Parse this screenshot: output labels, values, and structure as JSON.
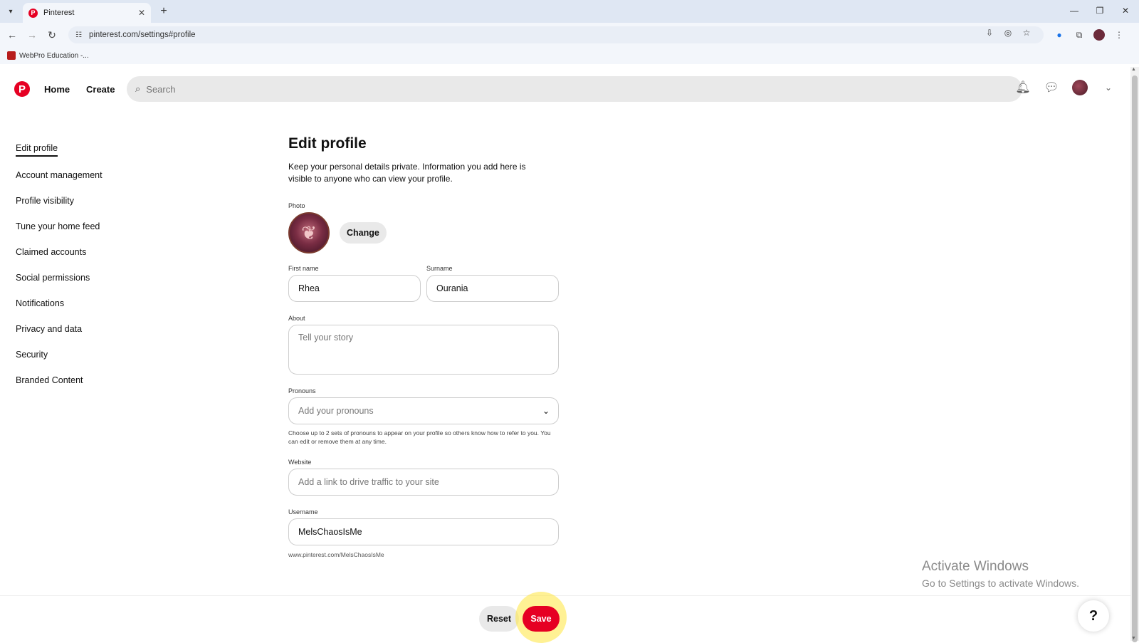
{
  "browser": {
    "tab_title": "Pinterest",
    "url": "pinterest.com/settings#profile",
    "bookmark": "WebPro Education -..."
  },
  "header": {
    "nav_home": "Home",
    "nav_create": "Create",
    "search_placeholder": "Search"
  },
  "sidebar": {
    "items": [
      {
        "label": "Edit profile"
      },
      {
        "label": "Account management"
      },
      {
        "label": "Profile visibility"
      },
      {
        "label": "Tune your home feed"
      },
      {
        "label": "Claimed accounts"
      },
      {
        "label": "Social permissions"
      },
      {
        "label": "Notifications"
      },
      {
        "label": "Privacy and data"
      },
      {
        "label": "Security"
      },
      {
        "label": "Branded Content"
      }
    ]
  },
  "form": {
    "title": "Edit profile",
    "description": "Keep your personal details private. Information you add here is visible to anyone who can view your profile.",
    "photo_label": "Photo",
    "change_button": "Change",
    "first_name_label": "First name",
    "first_name_value": "Rhea",
    "surname_label": "Surname",
    "surname_value": "Ourania",
    "about_label": "About",
    "about_placeholder": "Tell your story",
    "pronouns_label": "Pronouns",
    "pronouns_placeholder": "Add your pronouns",
    "pronouns_help": "Choose up to 2 sets of pronouns to appear on your profile so others know how to refer to you. You can edit or remove them at any time.",
    "website_label": "Website",
    "website_placeholder": "Add a link to drive traffic to your site",
    "username_label": "Username",
    "username_value": "MelsChaosIsMe",
    "profile_url": "www.pinterest.com/MelsChaosIsMe"
  },
  "actions": {
    "reset": "Reset",
    "save": "Save",
    "help": "?"
  },
  "watermark": {
    "line1": "Activate Windows",
    "line2": "Go to Settings to activate Windows."
  },
  "colors": {
    "brand": "#e60023",
    "accent_highlight": "#ffe63c"
  }
}
